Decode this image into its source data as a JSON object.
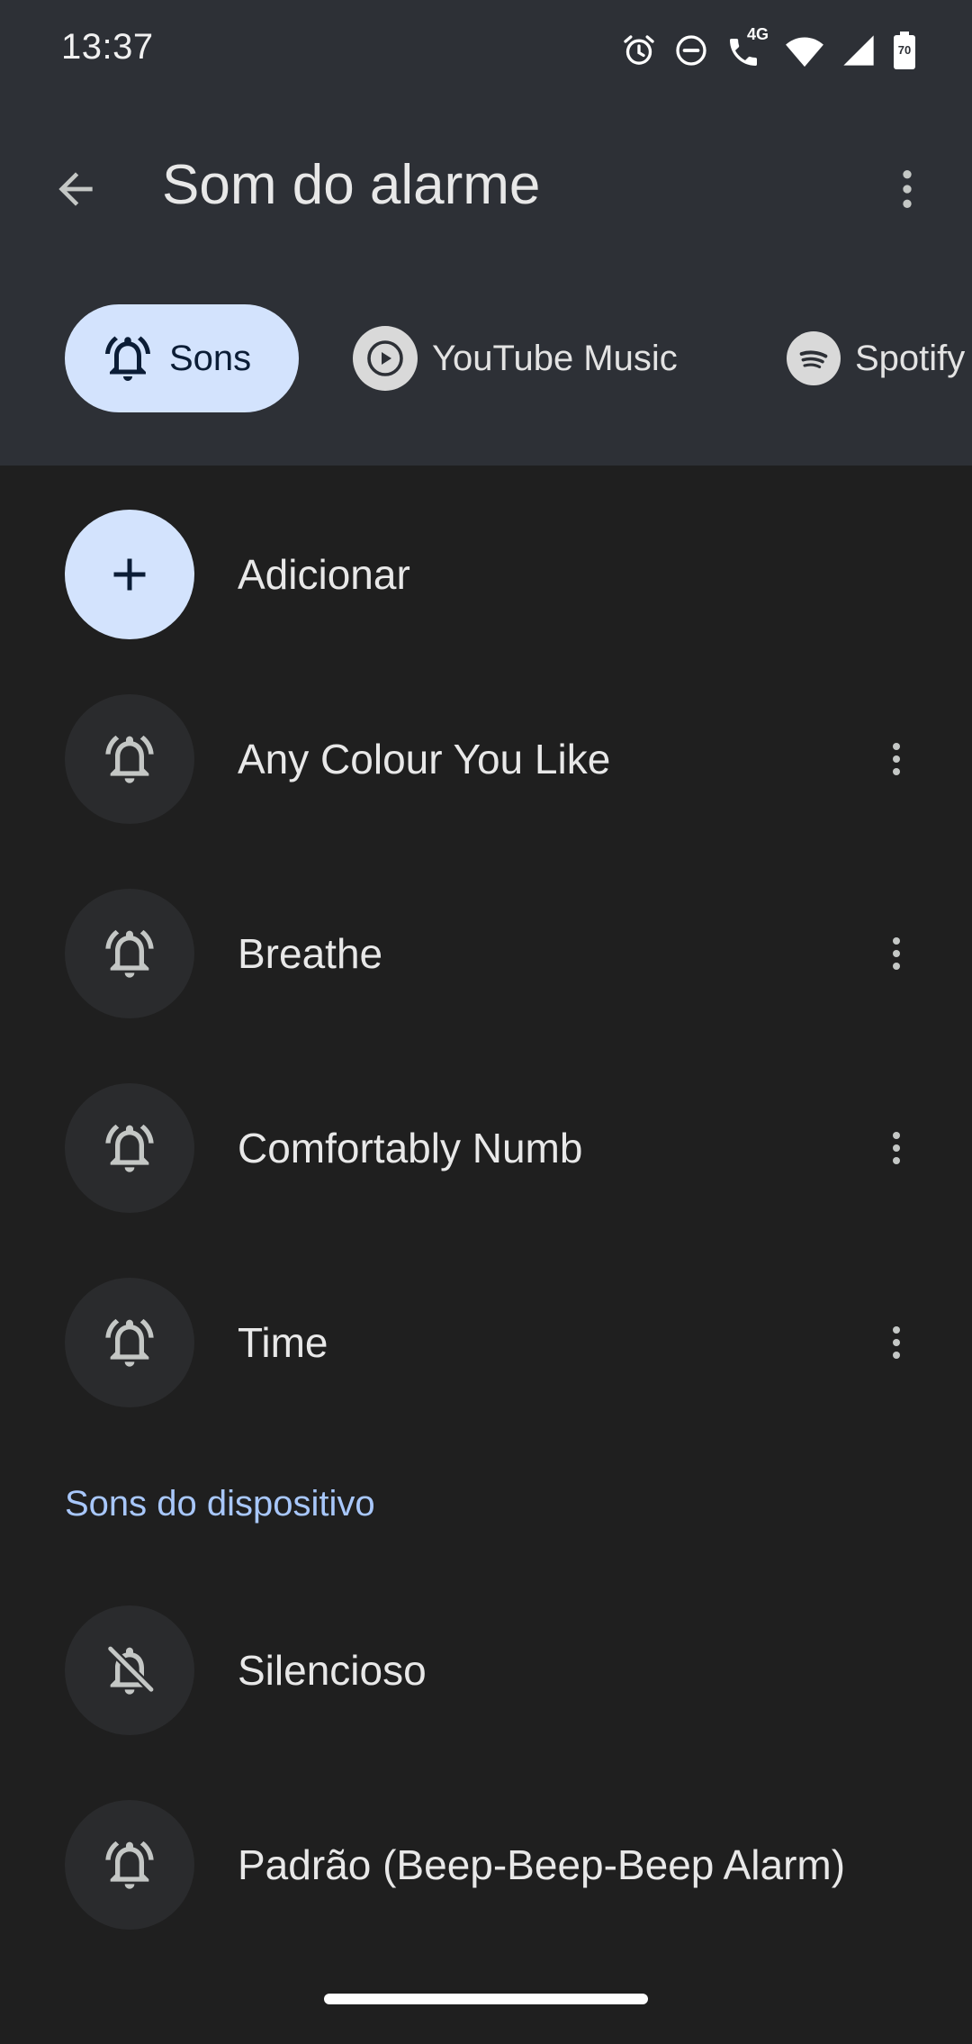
{
  "status_bar": {
    "time": "13:37",
    "battery_level": "70",
    "network_label": "4G",
    "icons": [
      "alarm-icon",
      "do-not-disturb-icon",
      "wifi-calling-icon",
      "wifi-icon",
      "cell-signal-icon",
      "battery-icon"
    ]
  },
  "app_bar": {
    "title": "Som do alarme",
    "back_icon": "arrow-back-icon",
    "overflow_icon": "more-vert-icon"
  },
  "tabs": [
    {
      "label": "Sons",
      "icon": "alarm-bell-icon",
      "selected": true
    },
    {
      "label": "YouTube Music",
      "icon": "youtube-music-icon",
      "selected": false
    },
    {
      "label": "Spotify",
      "icon": "spotify-icon",
      "selected": false
    }
  ],
  "list": {
    "add_label": "Adicionar",
    "custom_sounds": [
      {
        "label": "Any Colour You Like"
      },
      {
        "label": "Breathe"
      },
      {
        "label": "Comfortably Numb"
      },
      {
        "label": "Time"
      }
    ],
    "section_header": "Sons do dispositivo",
    "device_sounds": [
      {
        "label": "Silencioso",
        "icon": "alarm-off-icon"
      },
      {
        "label": "Padrão (Beep-Beep-Beep Alarm)",
        "icon": "alarm-bell-icon"
      }
    ]
  },
  "colors": {
    "header_bg": "#2d3036",
    "body_bg": "#1f1f1f",
    "accent": "#a8c7fa",
    "chip_selected_bg": "#d3e3fd",
    "avatar_bg": "#2a2b2d"
  }
}
